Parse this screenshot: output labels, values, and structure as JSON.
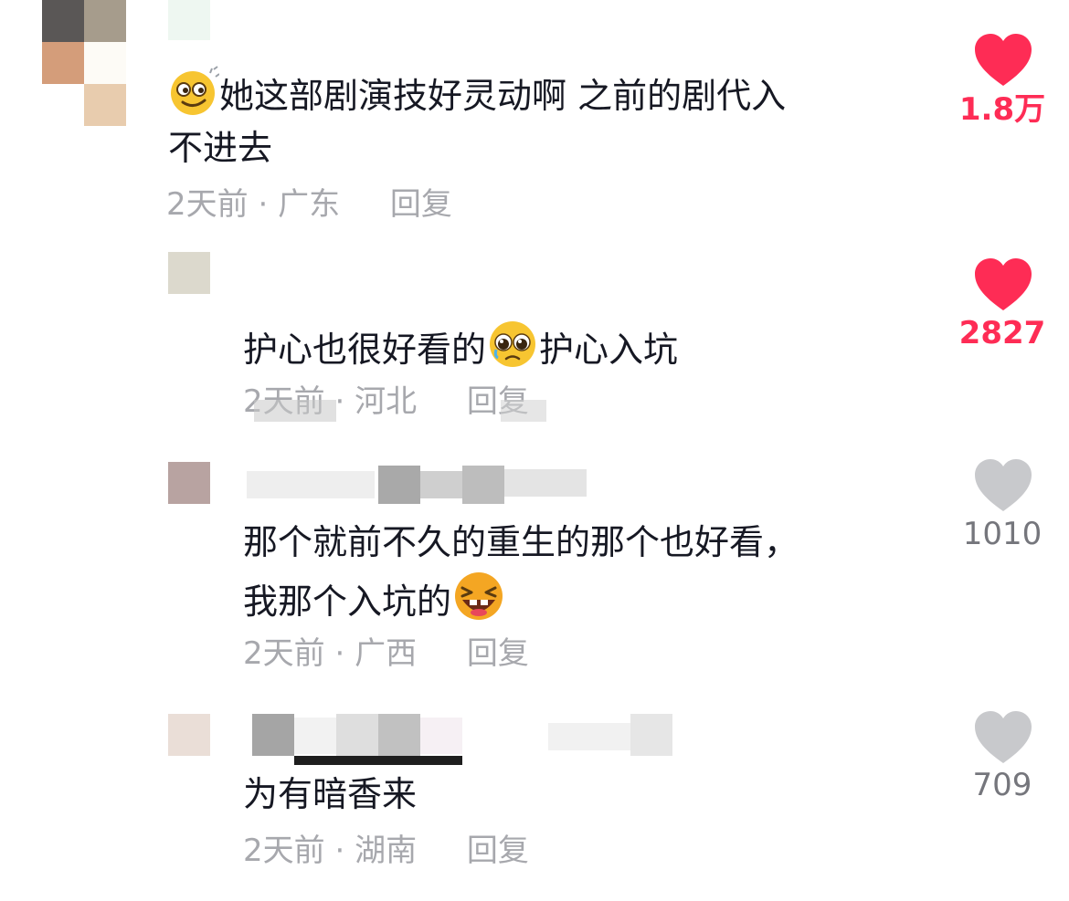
{
  "comments": [
    {
      "text_line1": "她这部剧演技好灵动啊 之前的剧代入",
      "text_line2": "不进去",
      "time": "2天前",
      "location": "广东",
      "reply_label": "回复",
      "likes": "1.8万",
      "liked": true,
      "emoji_icon": "dizzy-face-emoji-icon"
    },
    {
      "text_part1": "护心也很好看的",
      "text_part2": "护心入坑",
      "time": "2天前",
      "location": "河北",
      "reply_label": "回复",
      "likes": "2827",
      "liked": true,
      "emoji_icon": "pleading-face-emoji-icon"
    },
    {
      "text_line1": "那个就前不久的重生的那个也好看，",
      "text_line2": "我那个入坑的",
      "time": "2天前",
      "location": "广西",
      "reply_label": "回复",
      "likes": "1010",
      "liked": false,
      "emoji_icon": "laughing-face-emoji-icon"
    },
    {
      "text_line1": "为有暗香来",
      "time": "2天前",
      "location": "湖南",
      "reply_label": "回复",
      "likes": "709",
      "liked": false
    }
  ],
  "colors": {
    "liked": "#fe2c55",
    "unliked_heart": "#c8c9cc",
    "unliked_count": "#75767c",
    "meta": "#a7a8ad",
    "text": "#161823"
  },
  "separator": "·"
}
